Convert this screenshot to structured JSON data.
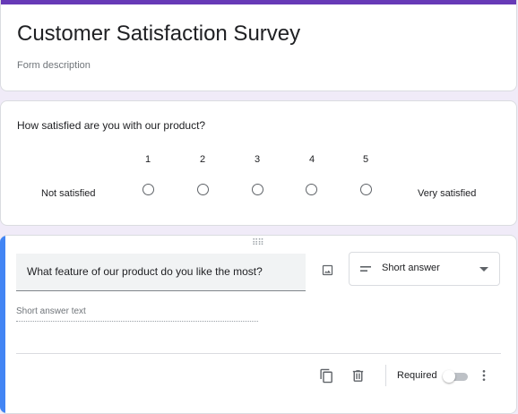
{
  "form": {
    "title": "Customer Satisfaction Survey",
    "description_placeholder": "Form description"
  },
  "questions": [
    {
      "title": "How satisfied are you with our product?",
      "type": "linear_scale",
      "scale_labels": [
        "1",
        "2",
        "3",
        "4",
        "5"
      ],
      "low_label": "Not satisfied",
      "high_label": "Very satisfied"
    },
    {
      "title": "What feature of our product do you like the most?",
      "type_label": "Short answer",
      "answer_placeholder": "Short answer text",
      "required_label": "Required",
      "required": false
    }
  ],
  "icons": {
    "drag": "drag-handle-icon",
    "image": "image-icon",
    "short_answer": "short-text-icon",
    "dropdown": "chevron-down-icon",
    "duplicate": "copy-icon",
    "delete": "trash-icon",
    "more": "more-vert-icon"
  },
  "colors": {
    "accent": "#673ab7",
    "active_question": "#4285f4",
    "background": "#f0ebf8"
  }
}
